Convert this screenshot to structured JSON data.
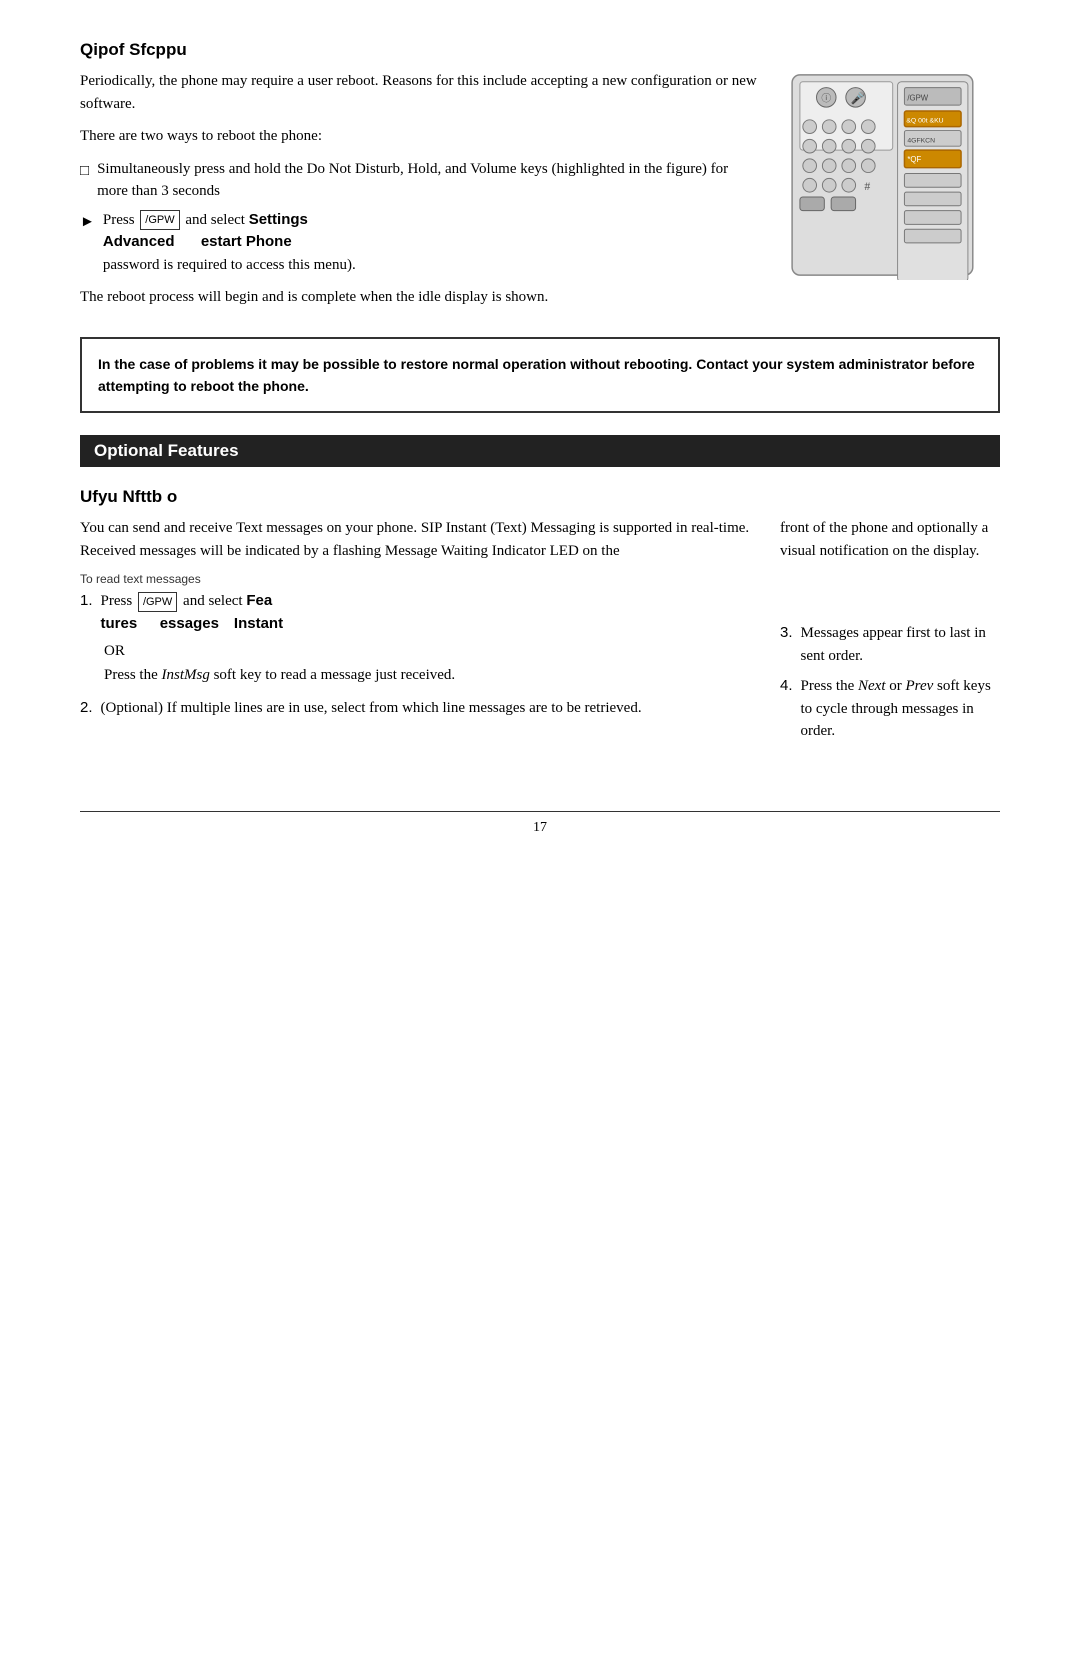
{
  "section1": {
    "title": "Qipof   Sfcppu",
    "para1": "Periodically, the phone may require a user reboot.  Reasons for this include accepting a new configuration or new software.",
    "para2": "There are two ways to reboot the phone:",
    "bullet1": "Simultaneously press and hold the Do Not Disturb, Hold, and Volume keys (highlighted in the figure) for more than 3 seconds",
    "press_label": "Press",
    "key_label": "/GPW",
    "select_text1": "and select",
    "bold_settings": "Settings",
    "bold_advanced": "Advanced",
    "bold_restart": "estart Phone",
    "password_note": "password is required to access this menu).",
    "para3": "The reboot process will begin and is complete when the idle display is shown.",
    "notice": "In the case of problems   it may be possible to restore normal operation without rebooting.  Contact your system administrator before attempting to reboot the phone."
  },
  "section2": {
    "header": "Optional Features",
    "title": "Ufyu   Nfttb   o",
    "para1": "You can send and receive Text messages on your phone.  SIP Instant (Text) Messaging is supported in real-time.  Received messages will be indicated by a flashing Message Waiting Indicator LED on the",
    "para1_right": "front of the phone and optionally a visual notification on the display.",
    "small_label": "To read text messages",
    "step1_press": "Press",
    "step1_key": "/GPW",
    "step1_select": "and select",
    "step1_bold1": "Fea",
    "step1_bold2": "tures",
    "step1_bold3": "essages",
    "step1_bold4": "Instant",
    "or_text": "OR",
    "step1_press2": "Press the",
    "step1_instmsg": "InstMsg",
    "step1_press2_rest": "soft key to read a message just received.",
    "step2": "(Optional)  If multiple lines are in use, select from which line messages are to be retrieved.",
    "step3": "Messages appear first to last in sent order.",
    "step4_text1": "Press the",
    "step4_next": "Next",
    "step4_or": "or",
    "step4_prev": "Prev",
    "step4_text2": "soft keys to cycle through messages in order.",
    "step3_label": "3.",
    "step4_label": "4."
  },
  "footer": {
    "page_number": "17"
  }
}
